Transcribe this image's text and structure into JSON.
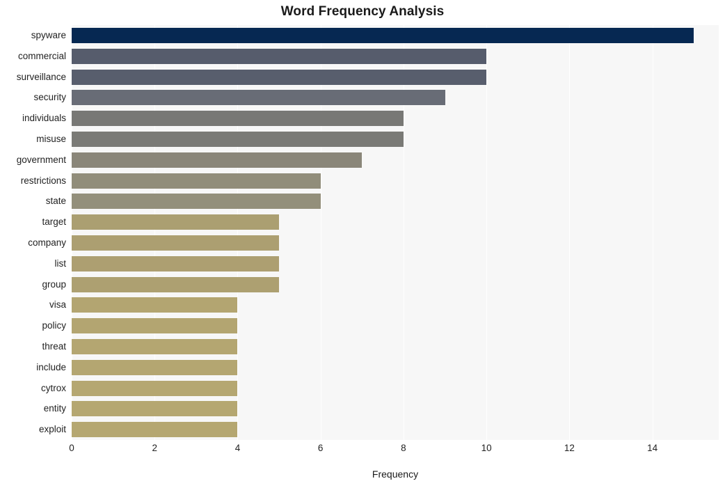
{
  "chart_data": {
    "type": "bar",
    "orientation": "horizontal",
    "title": "Word Frequency Analysis",
    "xlabel": "Frequency",
    "ylabel": "",
    "xlim": [
      0,
      15.6
    ],
    "ylim": null,
    "grid": true,
    "grid_axis": "x",
    "legend": false,
    "categories": [
      "spyware",
      "commercial",
      "surveillance",
      "security",
      "individuals",
      "misuse",
      "government",
      "restrictions",
      "state",
      "target",
      "company",
      "list",
      "group",
      "visa",
      "policy",
      "threat",
      "include",
      "cytrox",
      "entity",
      "exploit"
    ],
    "values": [
      15,
      10,
      10,
      9,
      8,
      8,
      7,
      6,
      6,
      5,
      5,
      5,
      5,
      4,
      4,
      4,
      4,
      4,
      4,
      4
    ],
    "xticks": [
      0,
      2,
      4,
      6,
      8,
      10,
      12,
      14
    ],
    "xticklabels": [
      "0",
      "2",
      "4",
      "6",
      "8",
      "10",
      "12",
      "14"
    ],
    "bar_colors": [
      "#062852",
      "#565c6c",
      "#585e6d",
      "#686c76",
      "#787875",
      "#7a7a76",
      "#8a8679",
      "#918d7a",
      "#938f7b",
      "#ab9f71",
      "#ac9f71",
      "#ad9f71",
      "#ada071",
      "#b3a571",
      "#b3a571",
      "#b4a671",
      "#b4a671",
      "#b5a771",
      "#b5a771",
      "#b5a771"
    ],
    "plot_background": "#f7f7f7",
    "gridline_color": "#ffffff",
    "figure_background": "#ffffff"
  }
}
